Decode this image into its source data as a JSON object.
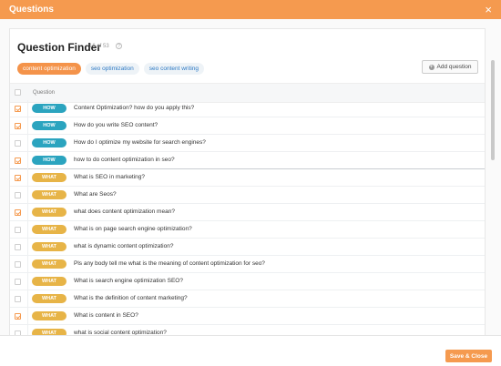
{
  "dialog": {
    "title": "Questions",
    "close_glyph": "×"
  },
  "finder": {
    "title": "Question Finder",
    "count": "16 of 53",
    "info_glyph": "?",
    "add_button": "Add question",
    "tags": [
      {
        "label": "content optimization",
        "active": true
      },
      {
        "label": "seo optimization",
        "active": false
      },
      {
        "label": "seo content writing",
        "active": false
      }
    ],
    "column_header": "Question"
  },
  "questions": [
    {
      "type": "HOW",
      "text": "Content Optimization? how do you apply this?",
      "checked": true
    },
    {
      "type": "HOW",
      "text": "How do you write SEO content?",
      "checked": true
    },
    {
      "type": "HOW",
      "text": "How do I optimize my website for search engines?",
      "checked": false
    },
    {
      "type": "HOW",
      "text": "how to do content optimization in seo?",
      "checked": true
    },
    {
      "type": "WHAT",
      "text": "What is SEO in marketing?",
      "checked": true
    },
    {
      "type": "WHAT",
      "text": "What are Seos?",
      "checked": false
    },
    {
      "type": "WHAT",
      "text": "what does content optimization mean?",
      "checked": true
    },
    {
      "type": "WHAT",
      "text": "What is on page search engine optimization?",
      "checked": false
    },
    {
      "type": "WHAT",
      "text": "what is dynamic content optimization?",
      "checked": false
    },
    {
      "type": "WHAT",
      "text": "Pls any body tell me what is the meaning of content optimization for seo?",
      "checked": false
    },
    {
      "type": "WHAT",
      "text": "What is search engine optimization SEO?",
      "checked": false
    },
    {
      "type": "WHAT",
      "text": "What is the definition of content marketing?",
      "checked": false
    },
    {
      "type": "WHAT",
      "text": "What is content in SEO?",
      "checked": true
    },
    {
      "type": "WHAT",
      "text": "what is social content optimization?",
      "checked": false
    }
  ],
  "footer": {
    "save_label": "Save & Close"
  },
  "colors": {
    "accent": "#f59a4f",
    "how_badge": "#2ba4bf",
    "what_badge": "#e7b447"
  }
}
